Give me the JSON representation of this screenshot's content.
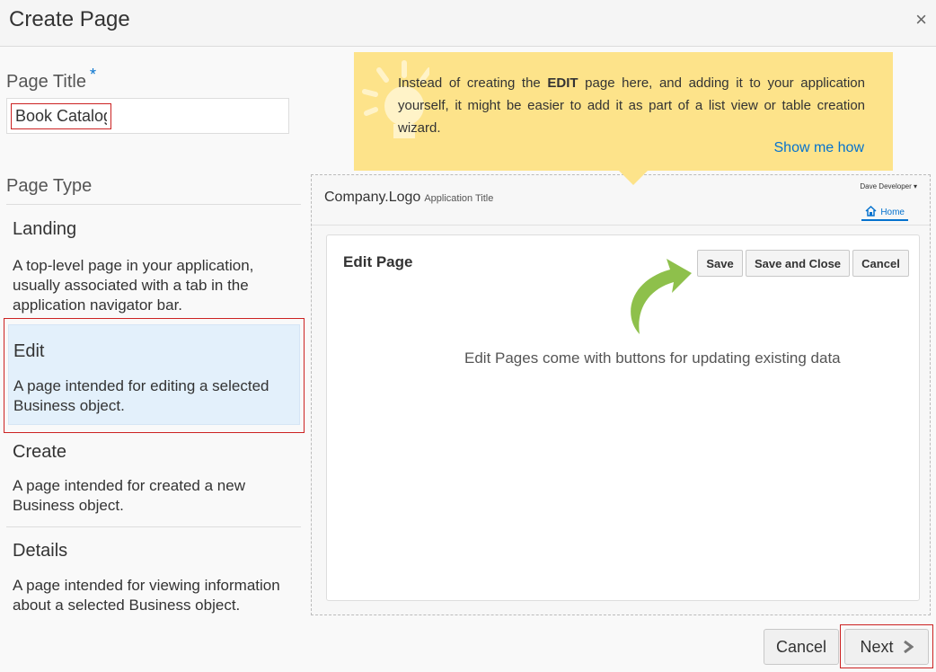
{
  "dialog": {
    "title": "Create Page",
    "close_glyph": "×"
  },
  "form": {
    "page_title_label": "Page Title",
    "required_mark": "*",
    "page_title_value": "Book Catalog",
    "page_type_label": "Page Type"
  },
  "page_types": [
    {
      "label": "Landing",
      "description": "A top-level page in your application, usually associated with a tab in the application navigator bar.",
      "selected": false
    },
    {
      "label": "Edit",
      "description": "A page intended for editing a selected Business object.",
      "selected": true
    },
    {
      "label": "Create",
      "description": "A page intended for created a new Business object.",
      "selected": false
    },
    {
      "label": "Details",
      "description": "A page intended for viewing information about a selected Business object.",
      "selected": false
    }
  ],
  "tip": {
    "text_before": "Instead of creating the ",
    "text_bold": "EDIT",
    "text_after": " page here, and adding it to your application yourself, it might be easier to add it as part of a list view or table creation wizard.",
    "link": "Show me how",
    "icon": "lightbulb-icon"
  },
  "preview": {
    "logo": "Company.Logo",
    "app_title": "Application Title",
    "user": "Dave Developer ▾",
    "home_tab": "Home",
    "card_title": "Edit Page",
    "buttons": {
      "save": "Save",
      "save_close": "Save and Close",
      "cancel": "Cancel"
    },
    "caption": "Edit Pages come with buttons for updating existing data"
  },
  "footer": {
    "cancel_label": "Cancel",
    "next_label": "Next"
  },
  "colors": {
    "accent": "#0572ce",
    "selection": "#e3f0fb",
    "tip": "#fde38a",
    "highlight": "#cc2222"
  }
}
